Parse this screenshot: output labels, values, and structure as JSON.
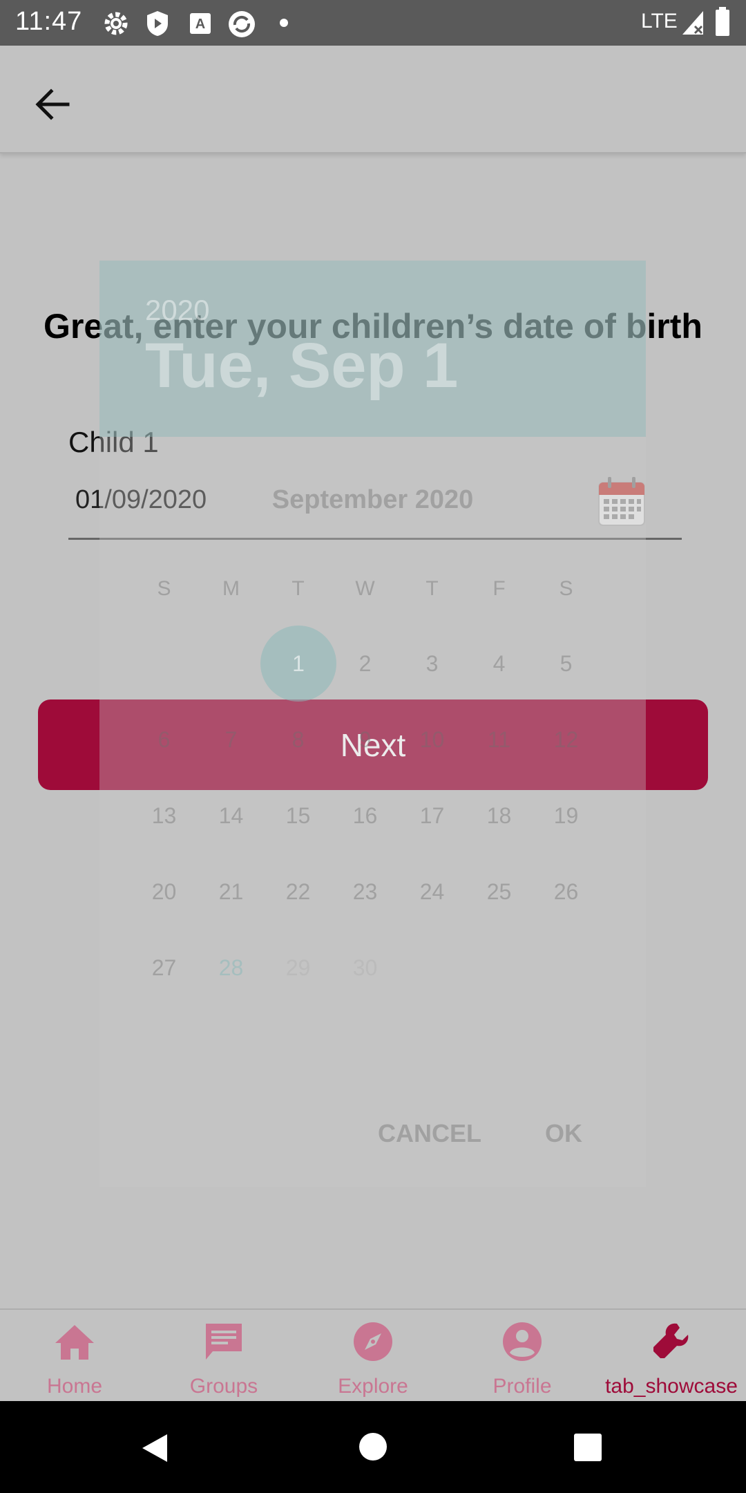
{
  "status_bar": {
    "time": "11:47",
    "network": "LTE",
    "icons": [
      "settings-icon",
      "shield-icon",
      "a-box-icon",
      "sync-icon",
      "dot-icon",
      "signal-icon",
      "battery-icon"
    ]
  },
  "app_bar": {
    "back_icon": "arrow-left-icon"
  },
  "content": {
    "heading": "Great, enter your children’s date of birth",
    "child_label": "Child 1",
    "date_value": "01/09/2020",
    "calendar_icon": "calendar-icon",
    "next_label": "Next",
    "accent_color": "#9e0b39"
  },
  "date_picker": {
    "year": "2020",
    "selected_date": "Tue, Sep 1",
    "month_title": "September 2020",
    "weekdays": [
      "S",
      "M",
      "T",
      "W",
      "T",
      "F",
      "S"
    ],
    "weeks": [
      [
        "",
        "",
        "1",
        "2",
        "3",
        "4",
        "5"
      ],
      [
        "6",
        "7",
        "8",
        "9",
        "10",
        "11",
        "12"
      ],
      [
        "13",
        "14",
        "15",
        "16",
        "17",
        "18",
        "19"
      ],
      [
        "20",
        "21",
        "22",
        "23",
        "24",
        "25",
        "26"
      ],
      [
        "27",
        "28",
        "29",
        "30",
        "",
        "",
        ""
      ]
    ],
    "selected_day": "1",
    "cancel_label": "CANCEL",
    "ok_label": "OK"
  },
  "bottom_nav": {
    "items": [
      {
        "label": "Home",
        "icon": "home-icon"
      },
      {
        "label": "Groups",
        "icon": "chat-icon"
      },
      {
        "label": "Explore",
        "icon": "compass-icon"
      },
      {
        "label": "Profile",
        "icon": "person-icon"
      },
      {
        "label": "tab_showcase",
        "icon": "wrench-icon"
      }
    ],
    "active_index": 4
  },
  "system_nav": {
    "icons": [
      "back-triangle-icon",
      "home-circle-icon",
      "recents-square-icon"
    ]
  }
}
